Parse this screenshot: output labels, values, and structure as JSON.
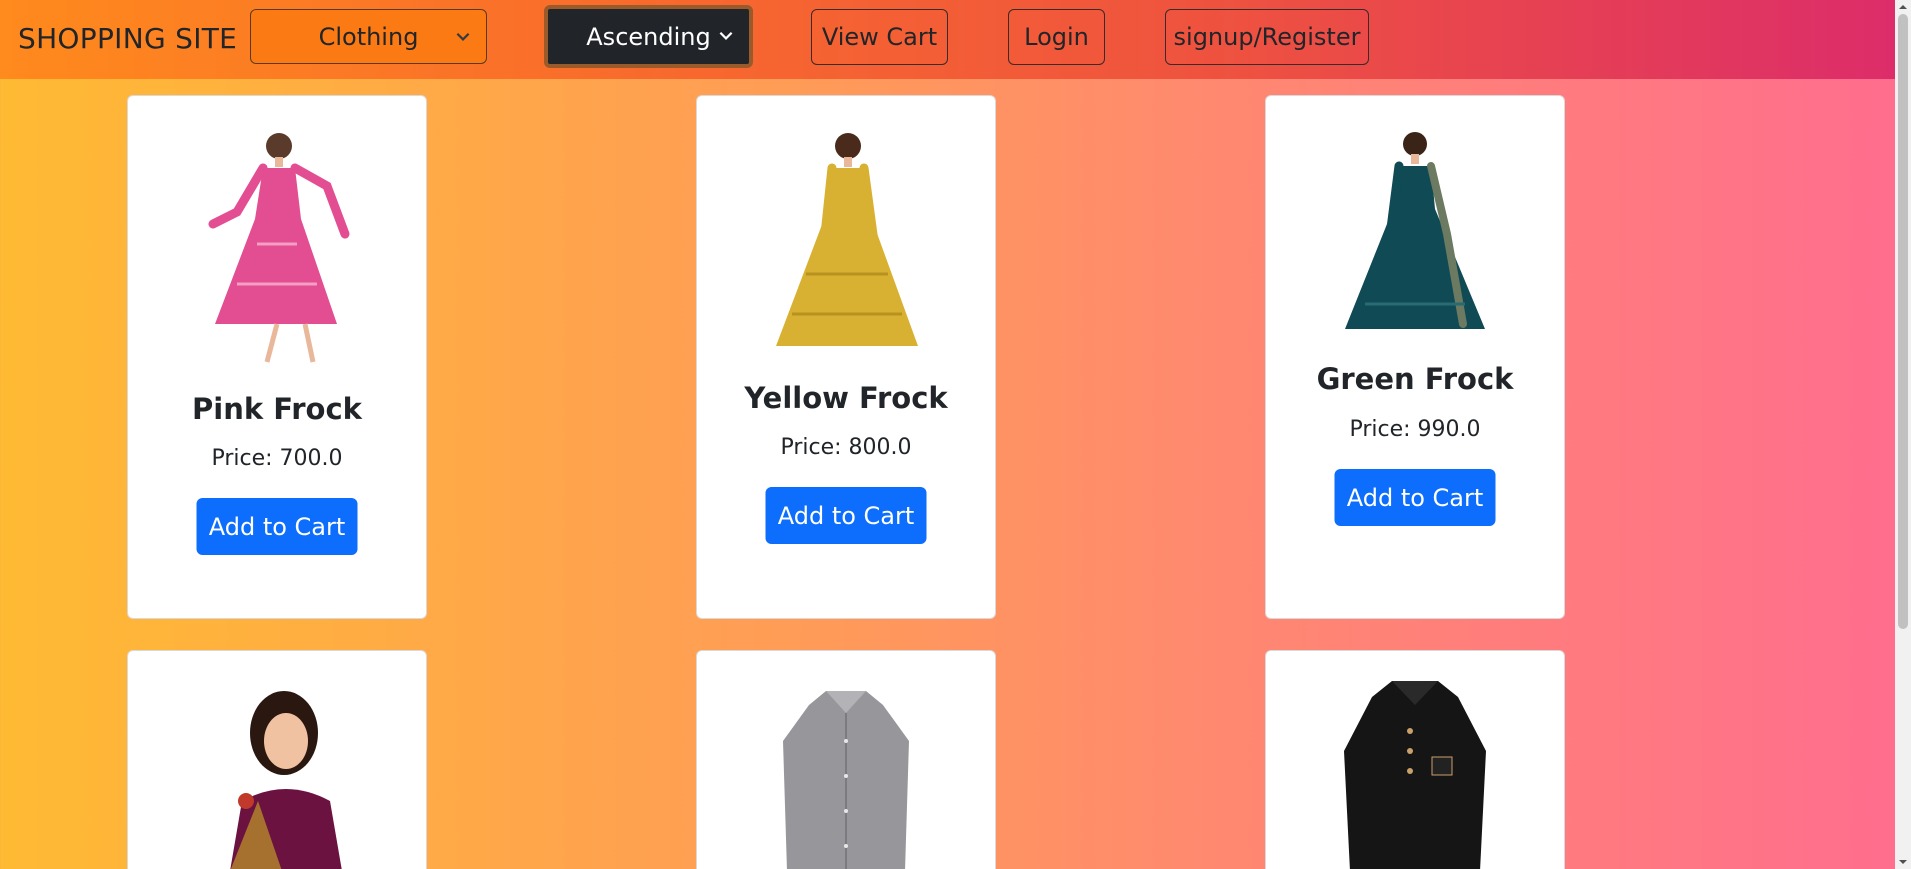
{
  "navbar": {
    "brand": "SHOPPING SITE",
    "category_select": {
      "value": "Clothing",
      "icon": "chevron-down-icon"
    },
    "order_select": {
      "value": "Ascending",
      "icon": "chevron-down-icon"
    },
    "view_cart": "View Cart",
    "login": "Login",
    "signup": "signup/Register"
  },
  "products": [
    {
      "title": "Pink Frock",
      "price": "Price: 700.0",
      "button": "Add to Cart",
      "color": "#e34d92"
    },
    {
      "title": "Yellow Frock",
      "price": "Price: 800.0",
      "button": "Add to Cart",
      "color": "#d9b132"
    },
    {
      "title": "Green Frock",
      "price": "Price: 990.0",
      "button": "Add to Cart",
      "color": "#0f4a55"
    },
    {
      "title": "",
      "price": "",
      "button": "",
      "color": "#6b1240"
    },
    {
      "title": "",
      "price": "",
      "button": "",
      "color": "#97969b"
    },
    {
      "title": "",
      "price": "",
      "button": "",
      "color": "#151515"
    }
  ],
  "colors": {
    "primary": "#0d6efd",
    "navbar_start": "#ff8a1d",
    "navbar_end": "#dc2c6b"
  }
}
